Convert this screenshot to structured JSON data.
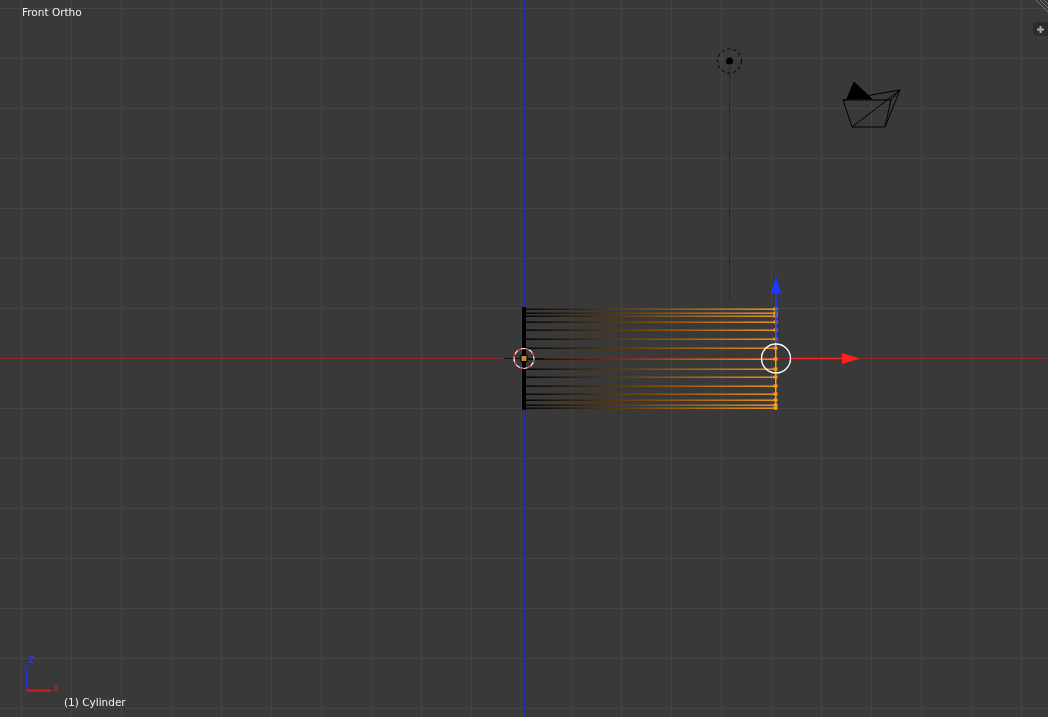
{
  "viewport": {
    "view_label": "Front Ortho",
    "object_label": "(1) Cylinder",
    "axis_labels": [
      "Z",
      "X"
    ]
  }
}
